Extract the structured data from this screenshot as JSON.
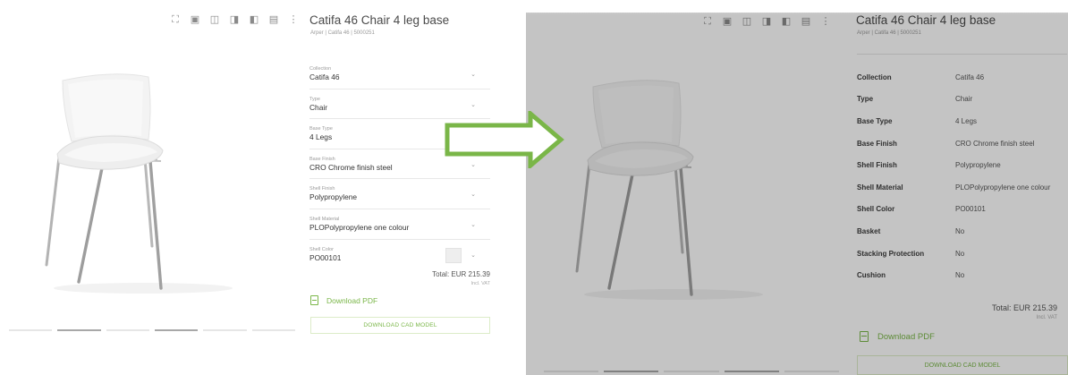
{
  "product": {
    "title": "Catifa 46 Chair 4 leg base",
    "subtitle": "Arper | Catifa 46 | 5000251"
  },
  "toolbar_icons": [
    "expand-icon",
    "view-front-icon",
    "view-side-icon",
    "view-3d-icon",
    "view-top-icon",
    "image-icon",
    "more-icon"
  ],
  "fields": [
    {
      "label": "Collection",
      "value": "Catifa 46"
    },
    {
      "label": "Type",
      "value": "Chair"
    },
    {
      "label": "Base Type",
      "value": "4 Legs"
    },
    {
      "label": "Base Finish",
      "value": "CRO Chrome finish steel"
    },
    {
      "label": "Shell Finish",
      "value": "Polypropylene"
    },
    {
      "label": "Shell Material",
      "value": "PLOPolypropylene one colour"
    },
    {
      "label": "Shell Color",
      "value": "PO00101"
    }
  ],
  "price": {
    "total": "Total: EUR 215.39",
    "vat": "Incl. VAT"
  },
  "actions": {
    "download_pdf": "Download PDF",
    "download_cad": "DOWNLOAD CAD MODEL"
  },
  "specs": [
    {
      "key": "Collection",
      "value": "Catifa 46"
    },
    {
      "key": "Type",
      "value": "Chair"
    },
    {
      "key": "Base Type",
      "value": "4 Legs"
    },
    {
      "key": "Base Finish",
      "value": "CRO Chrome finish steel"
    },
    {
      "key": "Shell Finish",
      "value": "Polypropylene"
    },
    {
      "key": "Shell Material",
      "value": "PLOPolypropylene one colour"
    },
    {
      "key": "Shell Color",
      "value": "PO00101"
    },
    {
      "key": "Basket",
      "value": "No"
    },
    {
      "key": "Stacking Protection",
      "value": "No"
    },
    {
      "key": "Cushion",
      "value": "No"
    }
  ],
  "colors": {
    "accent": "#7ab648",
    "arrow": "#7ab648"
  }
}
